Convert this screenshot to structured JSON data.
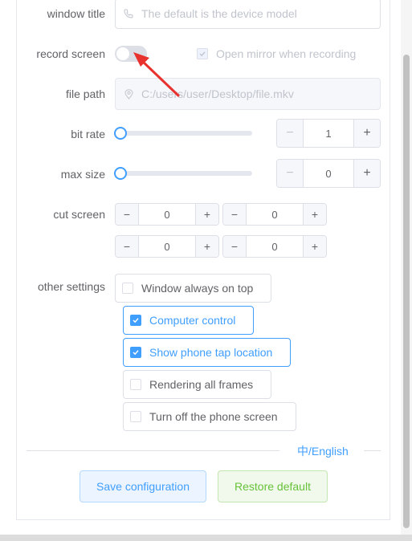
{
  "window_title": {
    "label": "window title",
    "placeholder": "The default is the device model"
  },
  "record_screen": {
    "label": "record screen",
    "enabled": false,
    "mirror_checkbox_label": "Open mirror when recording",
    "mirror_checked": true
  },
  "file_path": {
    "label": "file path",
    "placeholder": "C:/users/user/Desktop/file.mkv"
  },
  "bit_rate": {
    "label": "bit rate",
    "value": "1",
    "minus": "−",
    "plus": "+"
  },
  "max_size": {
    "label": "max size",
    "value": "0",
    "minus": "−",
    "plus": "+"
  },
  "cut_screen": {
    "label": "cut screen",
    "values": [
      "0",
      "0",
      "0",
      "0"
    ],
    "minus": "−",
    "plus": "+"
  },
  "other_settings": {
    "label": "other settings",
    "options": [
      {
        "label": "Window always on top",
        "checked": false
      },
      {
        "label": "Computer control",
        "checked": true
      },
      {
        "label": "Show phone tap location",
        "checked": true
      },
      {
        "label": "Rendering all frames",
        "checked": false
      },
      {
        "label": "Turn off the phone screen",
        "checked": false
      }
    ]
  },
  "language_link": "中/English",
  "actions": {
    "save": "Save configuration",
    "restore": "Restore default"
  },
  "colors": {
    "primary": "#409eff",
    "success": "#67c23a",
    "annotation_arrow": "#e8322d"
  },
  "icons": {
    "phone": "phone-icon",
    "location": "location-pin-icon",
    "check": "checkmark-icon",
    "arrow": "red-annotation-arrow"
  }
}
